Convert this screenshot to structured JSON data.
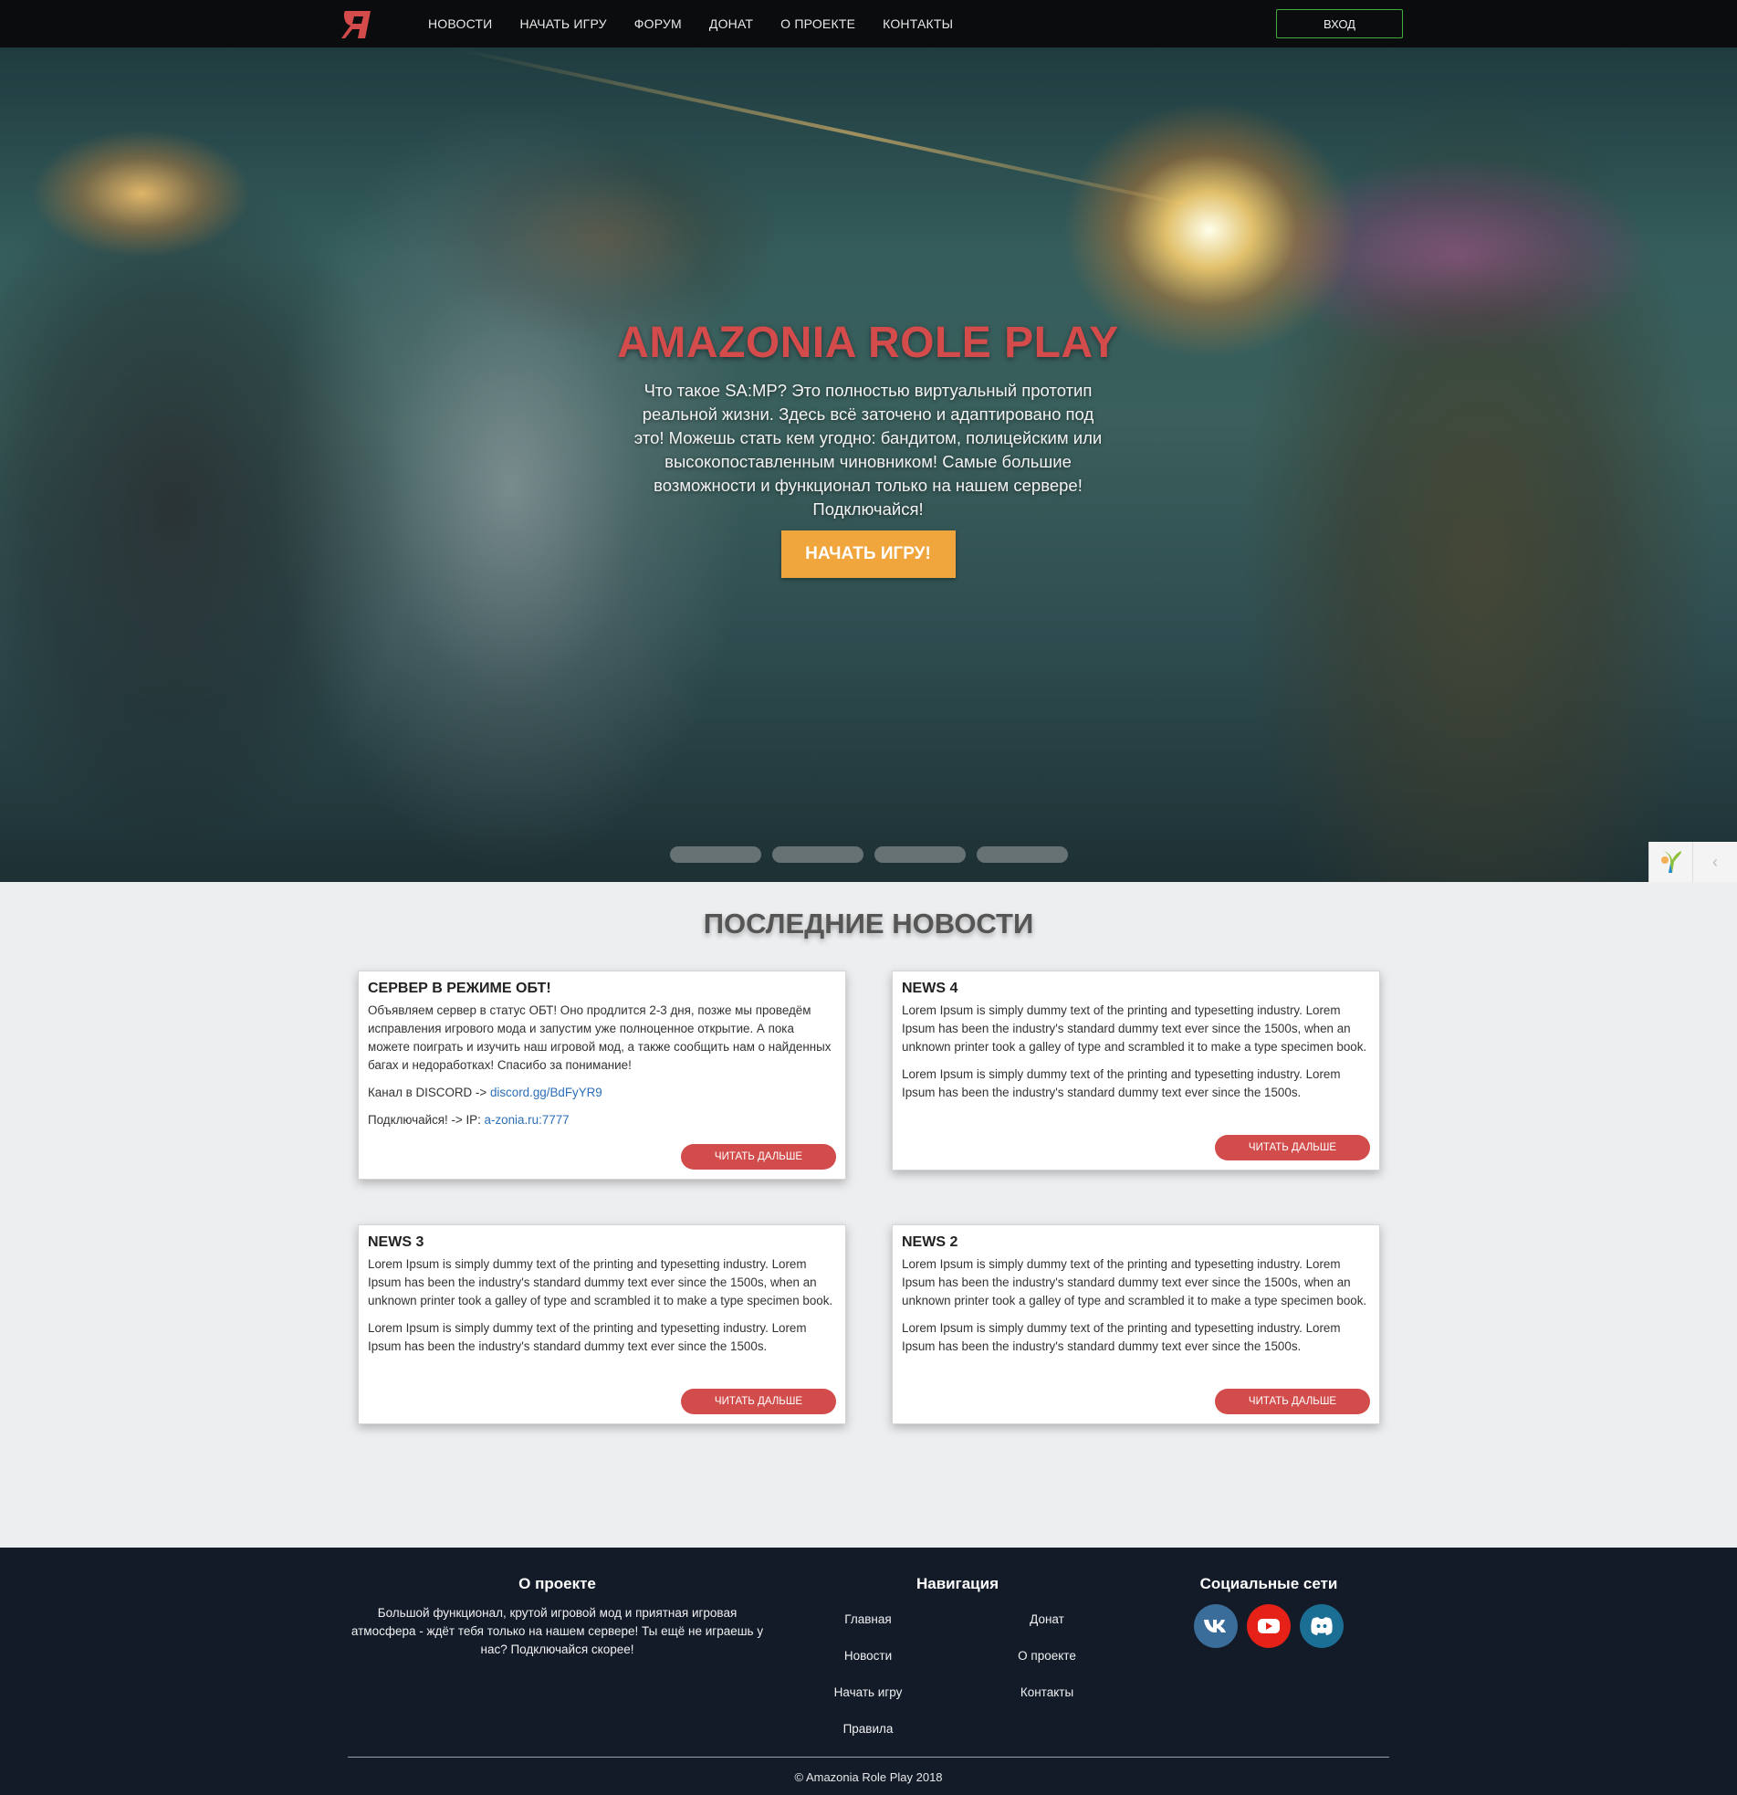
{
  "nav": {
    "logo_alt": "Я",
    "links": [
      "НОВОСТИ",
      "НАЧАТЬ ИГРУ",
      "ФОРУМ",
      "ДОНАТ",
      "О ПРОЕКТЕ",
      "КОНТАКТЫ"
    ],
    "login": "ВХОД"
  },
  "hero": {
    "title": "AMAZONIA ROLE PLAY",
    "text": "Что такое SA:MP? Это полностью виртуальный прототип реальной жизни. Здесь всё заточено и адаптировано под это! Можешь стать кем угодно: бандитом, полицейским или высокопоставленным чиновником! Самые большие возможности и функционал только на нашем сервере! Подключайся!",
    "button": "НАЧАТЬ ИГРУ!",
    "slides_count": 4
  },
  "news": {
    "heading": "ПОСЛЕДНИЕ НОВОСТИ",
    "read_more": "ЧИТАТЬ ДАЛЬШЕ",
    "cards": [
      {
        "title": "СЕРВЕР В РЕЖИМЕ ОБТ!",
        "p1": "Объявляем сервер в статус ОБТ! Оно продлится 2-3 дня, позже мы проведём исправления игрового мода и запустим уже полноценное открытие. А пока можете поиграть и изучить наш игровой мод, а также сообщить нам о найденных багах и недоработках! Спасибо за понимание!",
        "discord_prefix": "Канал в DISCORD -> ",
        "discord_link": "discord.gg/BdFyYR9",
        "ip_prefix": "Подключайся! -> IP: ",
        "ip_link": "a-zonia.ru:7777"
      },
      {
        "title": "NEWS 4",
        "p1": "Lorem Ipsum is simply dummy text of the printing and typesetting industry. Lorem Ipsum has been the industry's standard dummy text ever since the 1500s, when an unknown printer took a galley of type and scrambled it to make a type specimen book.",
        "p2": "Lorem Ipsum is simply dummy text of the printing and typesetting industry. Lorem Ipsum has been the industry's standard dummy text ever since the 1500s."
      },
      {
        "title": "NEWS 3",
        "p1": "Lorem Ipsum is simply dummy text of the printing and typesetting industry. Lorem Ipsum has been the industry's standard dummy text ever since the 1500s, when an unknown printer took a galley of type and scrambled it to make a type specimen book.",
        "p2": "Lorem Ipsum is simply dummy text of the printing and typesetting industry. Lorem Ipsum has been the industry's standard dummy text ever since the 1500s."
      },
      {
        "title": "NEWS 2",
        "p1": "Lorem Ipsum is simply dummy text of the printing and typesetting industry. Lorem Ipsum has been the industry's standard dummy text ever since the 1500s, when an unknown printer took a galley of type and scrambled it to make a type specimen book.",
        "p2": "Lorem Ipsum is simply dummy text of the printing and typesetting industry. Lorem Ipsum has been the industry's standard dummy text ever since the 1500s."
      }
    ]
  },
  "footer": {
    "about_title": "О проекте",
    "about_text": "Большой функционал, крутой игровой мод и приятная игровая атмосфера - ждёт тебя только на нашем сервере! Ты ещё не играешь у нас? Подключайся скорее!",
    "nav_title": "Навигация",
    "nav_links_left": [
      "Главная",
      "Новости",
      "Начать игру",
      "Правила"
    ],
    "nav_links_right": [
      "Донат",
      "О проекте",
      "Контакты"
    ],
    "social_title": "Социальные сети",
    "social": [
      {
        "name": "vk-icon",
        "color": "#3a6d99"
      },
      {
        "name": "youtube-icon",
        "color": "#e62117"
      },
      {
        "name": "discord-icon",
        "color": "#1c6f94"
      }
    ],
    "copyright": "© Amazonia Role Play 2018"
  },
  "colors": {
    "accent_red": "#d24c4c",
    "hero_button": "#f0a63c",
    "login_border": "#3fae3f",
    "footer_bg": "#131b29",
    "navbar_bg": "#0b0c0e"
  }
}
